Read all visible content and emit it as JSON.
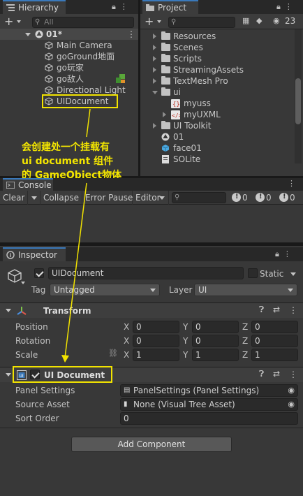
{
  "hierarchy": {
    "tab_title": "Hierarchy",
    "search_placeholder": "All",
    "scene_name": "01*",
    "items": [
      {
        "label": "Main Camera"
      },
      {
        "label": "goGround地面"
      },
      {
        "label": "go玩家"
      },
      {
        "label": "go敌人"
      },
      {
        "label": "Directional Light"
      },
      {
        "label": "UIDocument"
      }
    ]
  },
  "project": {
    "tab_title": "Project",
    "hidden_count": "23",
    "items": [
      {
        "label": "Resources",
        "kind": "folder"
      },
      {
        "label": "Scenes",
        "kind": "folder"
      },
      {
        "label": "Scripts",
        "kind": "folder"
      },
      {
        "label": "StreamingAssets",
        "kind": "folder"
      },
      {
        "label": "TextMesh Pro",
        "kind": "folder"
      },
      {
        "label": "ui",
        "kind": "folder-open"
      },
      {
        "label": "myuss",
        "kind": "uss"
      },
      {
        "label": "myUXML",
        "kind": "uxml"
      },
      {
        "label": "UI Toolkit",
        "kind": "folder"
      },
      {
        "label": "01",
        "kind": "scene"
      },
      {
        "label": "face01",
        "kind": "prefab"
      },
      {
        "label": "SQLite",
        "kind": "asset"
      }
    ]
  },
  "annotation": {
    "line1": "会创建处一个挂载有",
    "line2": "ui document 组件",
    "line3": "的 GameObject物体",
    "color": "#f2e300"
  },
  "console": {
    "tab_title": "Console",
    "clear": "Clear",
    "collapse": "Collapse",
    "error_pause": "Error Pause",
    "editor": "Editor",
    "counts": [
      "0",
      "0",
      "0"
    ]
  },
  "inspector": {
    "tab_title": "Inspector",
    "object_name": "UIDocument",
    "static_label": "Static",
    "tag_label": "Tag",
    "tag_value": "Untagged",
    "layer_label": "Layer",
    "layer_value": "UI",
    "transform": {
      "title": "Transform",
      "position_label": "Position",
      "rotation_label": "Rotation",
      "scale_label": "Scale",
      "axis_x": "X",
      "axis_y": "Y",
      "axis_z": "Z",
      "position": [
        "0",
        "0",
        "0"
      ],
      "rotation": [
        "0",
        "0",
        "0"
      ],
      "scale": [
        "1",
        "1",
        "1"
      ]
    },
    "ui_document": {
      "title": "UI Document",
      "panel_settings_label": "Panel Settings",
      "panel_settings_value": "PanelSettings (Panel Settings)",
      "source_asset_label": "Source Asset",
      "source_asset_value": "None (Visual Tree Asset)",
      "sort_order_label": "Sort Order",
      "sort_order_value": "0"
    },
    "add_component": "Add Component"
  },
  "colors": {
    "highlight": "#f2e300",
    "tab_accent": "#3a79bb",
    "panel_bg": "#383838"
  }
}
